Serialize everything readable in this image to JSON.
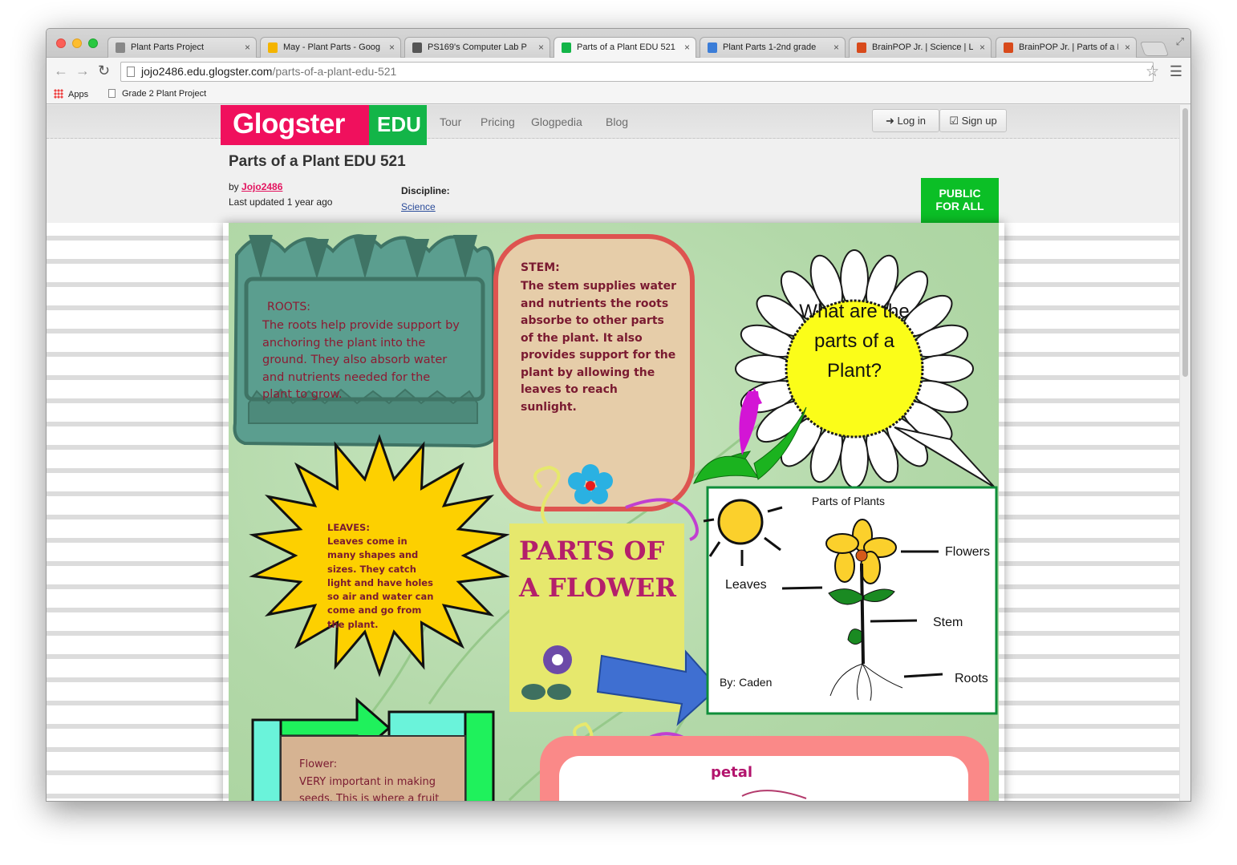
{
  "browser": {
    "tabs": [
      {
        "title": "Plant Parts Project",
        "icon_color": "#888888",
        "active": false
      },
      {
        "title": "May - Plant Parts - Goog",
        "icon_color": "#f4b400",
        "active": false
      },
      {
        "title": "PS169's Computer Lab P",
        "icon_color": "#555555",
        "active": false
      },
      {
        "title": "Parts of a Plant EDU 521",
        "icon_color": "#13b548",
        "active": true
      },
      {
        "title": "Plant Parts 1-2nd grade",
        "icon_color": "#3b7dd8",
        "active": false
      },
      {
        "title": "BrainPOP Jr. | Science | L",
        "icon_color": "#d84a1b",
        "active": false
      },
      {
        "title": "BrainPOP Jr. | Parts of a P",
        "icon_color": "#d84a1b",
        "active": false
      }
    ],
    "url_host": "jojo2486.edu.glogster.com",
    "url_path": "/parts-of-a-plant-edu-521",
    "bookmarks": {
      "apps": "Apps",
      "item1": "Grade 2 Plant Project"
    }
  },
  "site": {
    "logo_main": "Glogster",
    "logo_edu": "EDU",
    "nav": [
      "Tour",
      "Pricing",
      "Glogpedia",
      "Blog"
    ],
    "login": "Log in",
    "signup": "Sign up"
  },
  "glog": {
    "title": "Parts of a Plant EDU 521",
    "by_label": "by",
    "author": "Jojo2486",
    "updated": "Last updated 1 year ago",
    "discipline_label": "Discipline:",
    "discipline": "Science",
    "public_line1": "PUBLIC",
    "public_line2": "FOR ALL"
  },
  "poster": {
    "roots_title": "ROOTS:",
    "roots_text": "The roots help provide support by anchoring the plant into the ground.  They also absorb water and nutrients needed for the plant to grow.",
    "stem_title": "STEM:",
    "stem_text": "The stem  supplies water and nutrients the roots absorbe to other parts of the plant.  It also provides support for the plant by allowing the leaves to reach sunlight.",
    "question": "What are the parts of a Plant?",
    "leaves_title": "LEAVES:",
    "leaves_text": "Leaves come in many shapes and sizes. They catch light and have holes so air and water can come and go from the plant.",
    "flower_heading_1": "PARTS OF",
    "flower_heading_2": "A FLOWER",
    "diagram_title": "Parts of Plants",
    "diagram_labels": {
      "flowers": "Flowers",
      "leaves": "Leaves",
      "stem": "Stem",
      "roots": "Roots"
    },
    "diagram_credit": "By: Caden",
    "flower_title": "Flower:",
    "flower_text": "VERY important in making seeds.  This is where a fruit",
    "petal_label": "petal"
  }
}
